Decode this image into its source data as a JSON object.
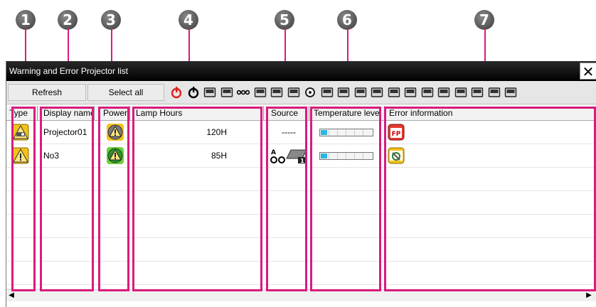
{
  "callouts": [
    "1",
    "2",
    "3",
    "4",
    "5",
    "6",
    "7"
  ],
  "window": {
    "title": "Warning and Error Projector list",
    "close_glyph": "✕"
  },
  "toolbar": {
    "refresh_label": "Refresh",
    "select_all_label": "Select all",
    "icons": [
      "power-on-icon",
      "power-off-icon",
      "input-source-icon",
      "input-source-2-icon",
      "dots-icon",
      "monitor-icon",
      "video-icon",
      "svideo-icon",
      "disc-icon",
      "lan-icon",
      "usb-icon",
      "input1-icon",
      "input2-icon",
      "hdmi-icon",
      "mp-icon",
      "network-icon",
      "computer1-icon",
      "computer2-icon",
      "wireless-icon",
      "display-icon",
      "remote-icon"
    ]
  },
  "columns": {
    "type": "Type",
    "display_name": "Display name",
    "power": "Power",
    "lamp_hours": "Lamp Hours",
    "source": "Source",
    "temperature": "Temperature level",
    "error_info": "Error information"
  },
  "rows": [
    {
      "name": "Projector01",
      "lamp_hours": "120H",
      "source": "-----",
      "temperature_fraction": 0.12,
      "error_icon": "fp-error-icon",
      "type_icon": "warning-projector-icon"
    },
    {
      "name": "No3",
      "lamp_hours": "85H",
      "source": "",
      "temperature_fraction": 0.12,
      "error_icon": "network-error-icon",
      "type_icon": "warning-icon"
    }
  ],
  "colors": {
    "highlight": "#d91b7e",
    "temp_fill": "#27b7e6",
    "warning_yellow": "#f3c21b"
  }
}
